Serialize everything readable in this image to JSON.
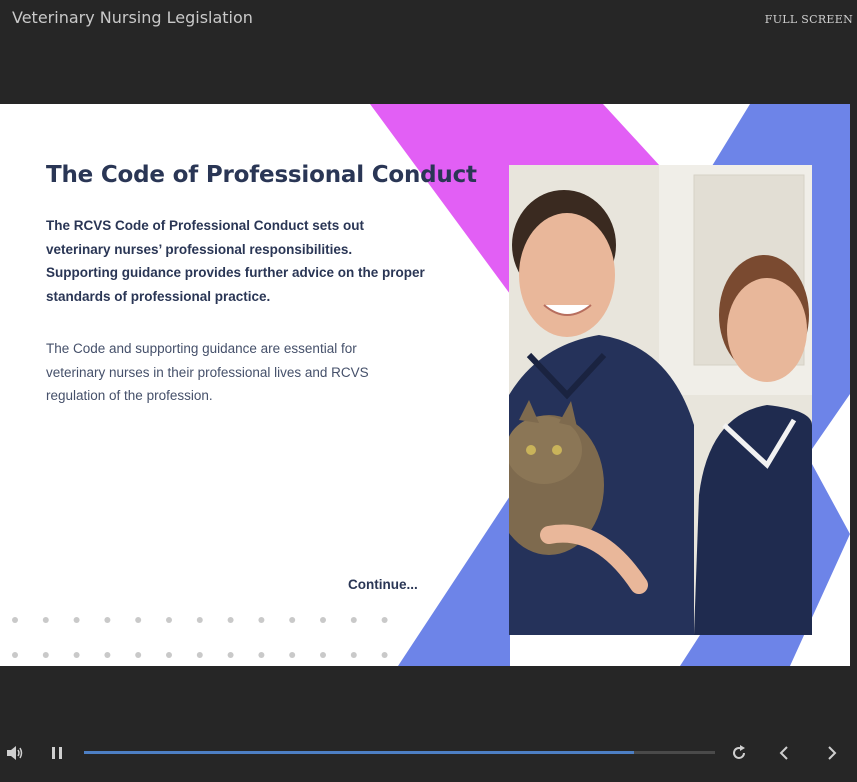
{
  "header": {
    "course_title": "Veterinary Nursing Legislation",
    "fullscreen_label": "FULL SCREEN"
  },
  "slide": {
    "title": "The Code of Professional Conduct",
    "intro": "The RCVS Code of Professional Conduct sets out veterinary nurses’ professional responsibilities. Supporting guidance provides further advice on the proper standards of professional practice.",
    "body": "The Code and supporting guidance are essential for veterinary nurses in their professional lives and RCVS regulation of the profession.",
    "continue_label": "Continue...",
    "image_icon": "veterinary-nurses-with-cat-photo"
  },
  "player": {
    "progress": 0.872,
    "volume_icon": "volume-icon",
    "pause_icon": "pause-icon",
    "replay_icon": "replay-icon",
    "prev_icon": "chevron-left-icon",
    "next_icon": "chevron-right-icon"
  },
  "colors": {
    "magenta": "#e25ff5",
    "blue": "#6d84e8",
    "title": "#2a3655",
    "progress": "#4d7fc4"
  }
}
